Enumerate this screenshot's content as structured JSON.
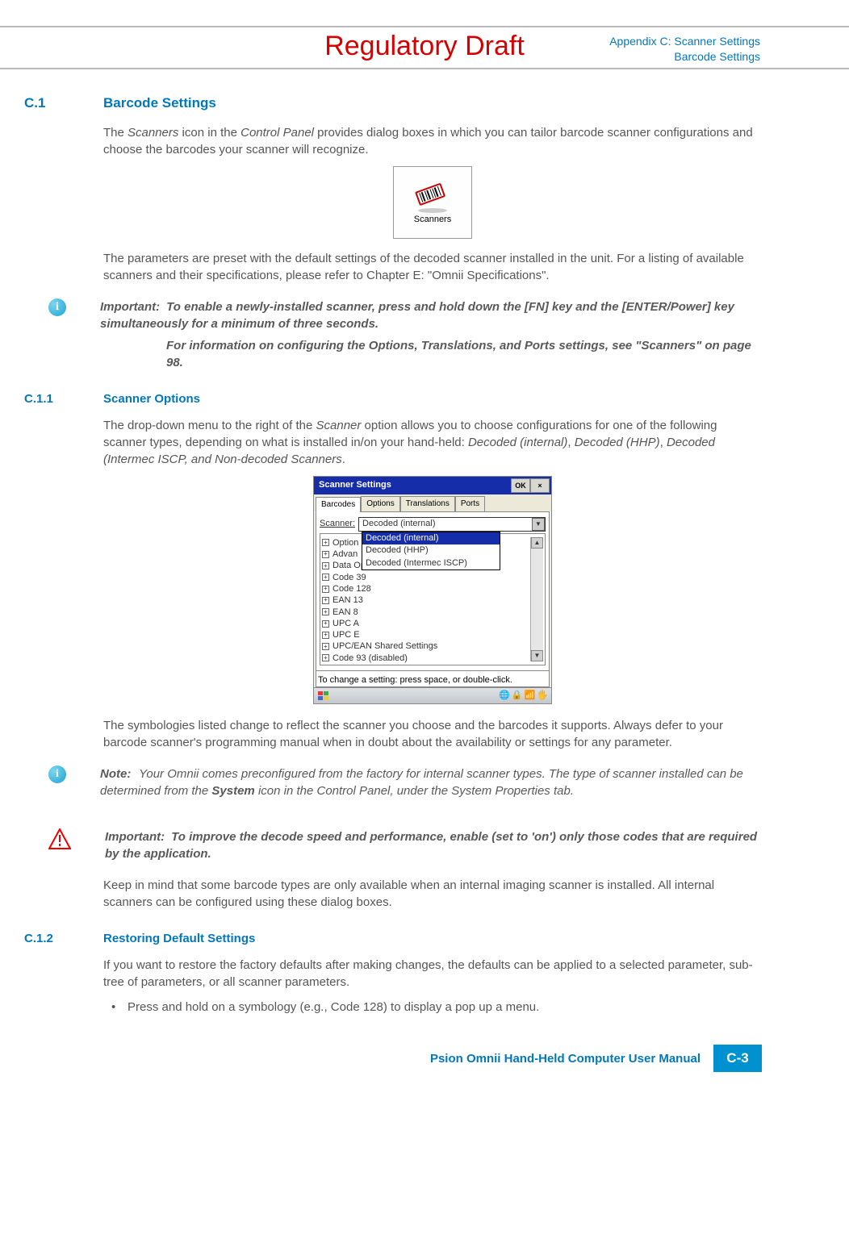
{
  "watermark": "Regulatory Draft",
  "header": {
    "line1": "Appendix C: Scanner Settings",
    "line2": "Barcode Settings"
  },
  "sec_c1": {
    "num": "C.1",
    "title": "Barcode Settings",
    "p1_a": "The ",
    "p1_b": "Scanners",
    "p1_c": " icon in the ",
    "p1_d": "Control Panel",
    "p1_e": " provides dialog boxes in which you can tailor barcode scanner configurations and choose the barcodes your scanner will recognize.",
    "icon_caption": "Scanners",
    "p2": "The parameters are preset with the default settings of the decoded scanner installed in the unit. For a listing of available scanners and their specifications, please refer to Chapter E: \"Omnii Specifications\"."
  },
  "important1": {
    "label": "Important:",
    "line1": "To enable a newly-installed scanner, press and hold down the [FN] key and the [ENTER/Power] key simultaneously for a minimum of three seconds.",
    "line2": "For information on configuring the Options, Translations, and Ports settings, see \"Scanners\" on page 98."
  },
  "sec_c11": {
    "num": "C.1.1",
    "title": "Scanner Options",
    "p1_a": "The drop-down menu to the right of the ",
    "p1_b": "Scanner",
    "p1_c": " option allows you to choose configurations for one of the following scanner types, depending on what is installed in/on your hand-held: ",
    "p1_d": "Decoded (internal)",
    "p1_comma1": ", ",
    "p1_e": "Decoded (HHP)",
    "p1_comma2": ", ",
    "p1_f": "Decoded (Intermec ISCP, and Non-decoded Scanners",
    "p1_g": ".",
    "p2": "The symbologies listed change to reflect the scanner you choose and the barcodes it supports. Always defer to your barcode scanner's programming manual when in doubt about the availability or settings for any parameter."
  },
  "screenshot": {
    "title": "Scanner Settings",
    "ok": "OK",
    "close": "×",
    "tabs": [
      "Barcodes",
      "Options",
      "Translations",
      "Ports"
    ],
    "scanner_label": "Scanner:",
    "scanner_value": "Decoded (internal)",
    "dropdown": [
      "Decoded (internal)",
      "Decoded (HHP)",
      "Decoded (Intermec ISCP)"
    ],
    "tree": [
      "Option",
      "Advan",
      "Data Options",
      "Code 39",
      "Code 128",
      "EAN 13",
      "EAN 8",
      "UPC A",
      "UPC E",
      "UPC/EAN Shared Settings",
      "Code 93 (disabled)"
    ],
    "hint": "To change a setting: press space, or double-click."
  },
  "note1": {
    "label": "Note:",
    "text_a": "Your Omnii comes preconfigured from the factory for internal scanner types. The type of scanner installed can be determined from the ",
    "text_b": "System",
    "text_c": " icon in the Control Panel, under the System Properties tab."
  },
  "important2": {
    "label": "Important:",
    "text": "To improve the decode speed and performance, enable (set to 'on') only those codes that are required by the application."
  },
  "p_after_imp2": "Keep in mind that some barcode types are only available when an internal imaging scanner is installed. All internal scanners can be configured using these dialog boxes.",
  "sec_c12": {
    "num": "C.1.2",
    "title": "Restoring Default Settings",
    "p1": "If you want to restore the factory defaults after making changes, the defaults can be applied to a selected parameter, sub-tree of parameters, or all scanner parameters.",
    "bullet1": "Press and hold on a symbology (e.g., Code 128) to display a pop up a menu."
  },
  "footer": {
    "text": "Psion Omnii Hand-Held Computer User Manual",
    "page": "C-3"
  }
}
